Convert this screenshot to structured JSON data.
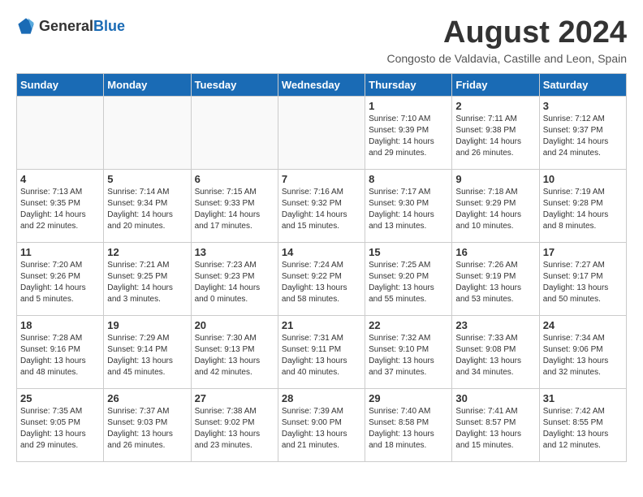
{
  "header": {
    "logo_general": "General",
    "logo_blue": "Blue",
    "month_title": "August 2024",
    "location": "Congosto de Valdavia, Castille and Leon, Spain"
  },
  "days_of_week": [
    "Sunday",
    "Monday",
    "Tuesday",
    "Wednesday",
    "Thursday",
    "Friday",
    "Saturday"
  ],
  "weeks": [
    [
      {
        "day": "",
        "info": ""
      },
      {
        "day": "",
        "info": ""
      },
      {
        "day": "",
        "info": ""
      },
      {
        "day": "",
        "info": ""
      },
      {
        "day": "1",
        "info": "Sunrise: 7:10 AM\nSunset: 9:39 PM\nDaylight: 14 hours\nand 29 minutes."
      },
      {
        "day": "2",
        "info": "Sunrise: 7:11 AM\nSunset: 9:38 PM\nDaylight: 14 hours\nand 26 minutes."
      },
      {
        "day": "3",
        "info": "Sunrise: 7:12 AM\nSunset: 9:37 PM\nDaylight: 14 hours\nand 24 minutes."
      }
    ],
    [
      {
        "day": "4",
        "info": "Sunrise: 7:13 AM\nSunset: 9:35 PM\nDaylight: 14 hours\nand 22 minutes."
      },
      {
        "day": "5",
        "info": "Sunrise: 7:14 AM\nSunset: 9:34 PM\nDaylight: 14 hours\nand 20 minutes."
      },
      {
        "day": "6",
        "info": "Sunrise: 7:15 AM\nSunset: 9:33 PM\nDaylight: 14 hours\nand 17 minutes."
      },
      {
        "day": "7",
        "info": "Sunrise: 7:16 AM\nSunset: 9:32 PM\nDaylight: 14 hours\nand 15 minutes."
      },
      {
        "day": "8",
        "info": "Sunrise: 7:17 AM\nSunset: 9:30 PM\nDaylight: 14 hours\nand 13 minutes."
      },
      {
        "day": "9",
        "info": "Sunrise: 7:18 AM\nSunset: 9:29 PM\nDaylight: 14 hours\nand 10 minutes."
      },
      {
        "day": "10",
        "info": "Sunrise: 7:19 AM\nSunset: 9:28 PM\nDaylight: 14 hours\nand 8 minutes."
      }
    ],
    [
      {
        "day": "11",
        "info": "Sunrise: 7:20 AM\nSunset: 9:26 PM\nDaylight: 14 hours\nand 5 minutes."
      },
      {
        "day": "12",
        "info": "Sunrise: 7:21 AM\nSunset: 9:25 PM\nDaylight: 14 hours\nand 3 minutes."
      },
      {
        "day": "13",
        "info": "Sunrise: 7:23 AM\nSunset: 9:23 PM\nDaylight: 14 hours\nand 0 minutes."
      },
      {
        "day": "14",
        "info": "Sunrise: 7:24 AM\nSunset: 9:22 PM\nDaylight: 13 hours\nand 58 minutes."
      },
      {
        "day": "15",
        "info": "Sunrise: 7:25 AM\nSunset: 9:20 PM\nDaylight: 13 hours\nand 55 minutes."
      },
      {
        "day": "16",
        "info": "Sunrise: 7:26 AM\nSunset: 9:19 PM\nDaylight: 13 hours\nand 53 minutes."
      },
      {
        "day": "17",
        "info": "Sunrise: 7:27 AM\nSunset: 9:17 PM\nDaylight: 13 hours\nand 50 minutes."
      }
    ],
    [
      {
        "day": "18",
        "info": "Sunrise: 7:28 AM\nSunset: 9:16 PM\nDaylight: 13 hours\nand 48 minutes."
      },
      {
        "day": "19",
        "info": "Sunrise: 7:29 AM\nSunset: 9:14 PM\nDaylight: 13 hours\nand 45 minutes."
      },
      {
        "day": "20",
        "info": "Sunrise: 7:30 AM\nSunset: 9:13 PM\nDaylight: 13 hours\nand 42 minutes."
      },
      {
        "day": "21",
        "info": "Sunrise: 7:31 AM\nSunset: 9:11 PM\nDaylight: 13 hours\nand 40 minutes."
      },
      {
        "day": "22",
        "info": "Sunrise: 7:32 AM\nSunset: 9:10 PM\nDaylight: 13 hours\nand 37 minutes."
      },
      {
        "day": "23",
        "info": "Sunrise: 7:33 AM\nSunset: 9:08 PM\nDaylight: 13 hours\nand 34 minutes."
      },
      {
        "day": "24",
        "info": "Sunrise: 7:34 AM\nSunset: 9:06 PM\nDaylight: 13 hours\nand 32 minutes."
      }
    ],
    [
      {
        "day": "25",
        "info": "Sunrise: 7:35 AM\nSunset: 9:05 PM\nDaylight: 13 hours\nand 29 minutes."
      },
      {
        "day": "26",
        "info": "Sunrise: 7:37 AM\nSunset: 9:03 PM\nDaylight: 13 hours\nand 26 minutes."
      },
      {
        "day": "27",
        "info": "Sunrise: 7:38 AM\nSunset: 9:02 PM\nDaylight: 13 hours\nand 23 minutes."
      },
      {
        "day": "28",
        "info": "Sunrise: 7:39 AM\nSunset: 9:00 PM\nDaylight: 13 hours\nand 21 minutes."
      },
      {
        "day": "29",
        "info": "Sunrise: 7:40 AM\nSunset: 8:58 PM\nDaylight: 13 hours\nand 18 minutes."
      },
      {
        "day": "30",
        "info": "Sunrise: 7:41 AM\nSunset: 8:57 PM\nDaylight: 13 hours\nand 15 minutes."
      },
      {
        "day": "31",
        "info": "Sunrise: 7:42 AM\nSunset: 8:55 PM\nDaylight: 13 hours\nand 12 minutes."
      }
    ]
  ]
}
